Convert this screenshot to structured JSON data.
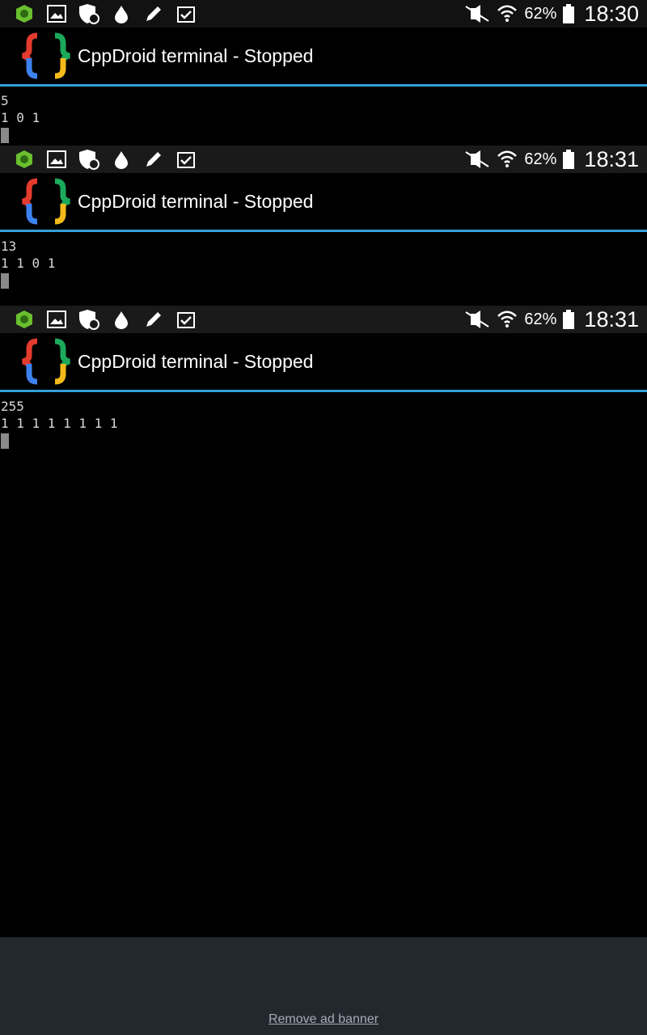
{
  "status_icons": [
    "pest-icon",
    "image-icon",
    "shield-sync-icon",
    "drop-icon",
    "pencil-icon",
    "clipboard-check-icon"
  ],
  "system_icons": [
    "mute-icon",
    "wifi-icon",
    "battery-icon"
  ],
  "screens": [
    {
      "battery_percent": "62%",
      "time": "18:30",
      "title": "CppDroid terminal - Stopped",
      "output_lines": [
        "5",
        "1 0 1"
      ]
    },
    {
      "battery_percent": "62%",
      "time": "18:31",
      "title": "CppDroid terminal - Stopped",
      "output_lines": [
        "13",
        "1 1 0 1"
      ]
    },
    {
      "battery_percent": "62%",
      "time": "18:31",
      "title": "CppDroid terminal - Stopped",
      "output_lines": [
        "255",
        "1 1 1 1 1 1 1 1"
      ]
    }
  ],
  "ad": {
    "remove_label": "Remove ad banner"
  },
  "colors": {
    "accent_line": "#33a0da",
    "ad_background": "#23272e"
  }
}
